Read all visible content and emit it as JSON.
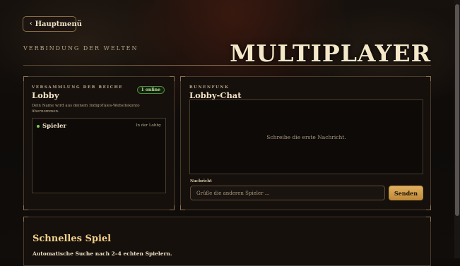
{
  "nav": {
    "back_label": "Hauptmenü"
  },
  "header": {
    "subtitle": "VERBINDUNG DER WELTEN",
    "title": "MULTIPLAYER"
  },
  "lobby": {
    "eyebrow": "VERSAMMLUNG DER REICHE",
    "title": "Lobby",
    "online_badge": "1 online",
    "note": "Dein Name wird aus deinem IndigoTales-Websitekonto übernommen.",
    "players": [
      {
        "name": "Spieler",
        "status": "In der Lobby"
      }
    ]
  },
  "chat": {
    "eyebrow": "RUNENFUNK",
    "title": "Lobby-Chat",
    "empty_text": "Schreibe die erste Nachricht.",
    "message_label": "Nachricht",
    "input_value": "",
    "input_placeholder": "Grüße die anderen Spieler ...",
    "send_label": "Senden"
  },
  "quick_match": {
    "title": "Schnelles Spiel",
    "description": "Automatische Suche nach 2–4 echten Spielern."
  },
  "colors": {
    "background": "#0f0c0a",
    "accent_gold": "#e0b060",
    "online_green": "#7ccc5a",
    "panel_border": "#4a3c2b"
  }
}
